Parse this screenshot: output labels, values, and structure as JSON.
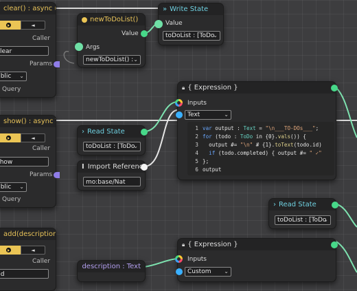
{
  "nodes": {
    "clear": {
      "title": "clear() : async ()",
      "caller": "Caller",
      "caller_value": "clear",
      "params": "Params",
      "params_value": "ublic",
      "query": "Query",
      "btn_glyph": "◄"
    },
    "new_todo": {
      "title": "newToDoList()",
      "value_label": "Value",
      "args_label": "Args",
      "select_value": "newToDoList() :"
    },
    "write_state": {
      "title": "Write State",
      "value_label": "Value",
      "select_value": "toDoList : [ToDo"
    },
    "expression1": {
      "title": "{ Expression }",
      "inputs_label": "Inputs",
      "type_value": "Text",
      "line_numbers": [
        "1",
        "2",
        "3",
        "4",
        "5",
        "6"
      ],
      "code": [
        [
          {
            "c": "kw",
            "t": "var"
          },
          {
            "c": "",
            "t": " output : "
          },
          {
            "c": "ty",
            "t": "Text"
          },
          {
            "c": "",
            "t": " = "
          },
          {
            "c": "str",
            "t": "\"\\n___TO-DOs___\""
          },
          {
            "c": "",
            "t": ";"
          }
        ],
        [
          {
            "c": "kw",
            "t": "for"
          },
          {
            "c": "",
            "t": " (todo : "
          },
          {
            "c": "ty",
            "t": "ToDo"
          },
          {
            "c": "",
            "t": " in {0}."
          },
          {
            "c": "fn",
            "t": "vals"
          },
          {
            "c": "",
            "t": "()) {"
          }
        ],
        [
          {
            "c": "",
            "t": "  output #= "
          },
          {
            "c": "str",
            "t": "\"\\n\""
          },
          {
            "c": "",
            "t": " # {1}."
          },
          {
            "c": "fn",
            "t": "toText"
          },
          {
            "c": "",
            "t": "(todo.id)"
          }
        ],
        [
          {
            "c": "",
            "t": "  "
          },
          {
            "c": "kw",
            "t": "if"
          },
          {
            "c": "",
            "t": " (todo.completed) { output #= "
          },
          {
            "c": "str",
            "t": "\" ✓\""
          }
        ],
        [
          {
            "c": "",
            "t": "};"
          }
        ],
        [
          {
            "c": "",
            "t": "output"
          }
        ]
      ]
    },
    "show": {
      "title": "show() : async Tex",
      "caller": "Caller",
      "caller_value": "show",
      "params": "Params",
      "params_value": "ublic",
      "query": "Query",
      "btn_glyph": "◄"
    },
    "read_state1": {
      "title": "Read State",
      "select_value": "toDoList : [ToDo"
    },
    "import_ref": {
      "title": "Import Reference",
      "field_value": "mo:base/Nat"
    },
    "read_state2": {
      "title": "Read State",
      "select_value": "toDoList : [ToDo"
    },
    "add": {
      "title": "add(description :",
      "caller": "Caller",
      "caller_value": "dd",
      "btn_glyph": "◄"
    },
    "description": {
      "title": "description : Text"
    },
    "expression2": {
      "title": "{ Expression }",
      "inputs_label": "Inputs",
      "type_value": "Custom"
    }
  },
  "colors": {
    "accent_gold": "#ebc555",
    "pin_green": "#47d889",
    "pin_blue": "#3ab0ff",
    "wire": "#7ee3b0",
    "exec_wire": "#d8d8d8"
  }
}
